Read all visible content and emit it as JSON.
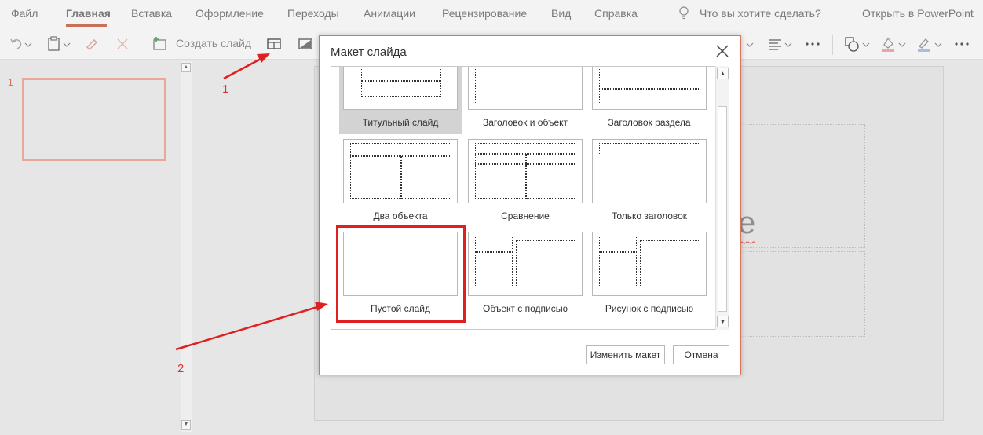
{
  "ribbon": {
    "tabs": [
      "Файл",
      "Главная",
      "Вставка",
      "Оформление",
      "Переходы",
      "Анимации",
      "Рецензирование",
      "Вид",
      "Справка"
    ],
    "active_tab": "Главная",
    "tell_me": "Что вы хотите сделать?",
    "open_in_app": "Открыть в PowerPoint"
  },
  "toolbar": {
    "new_slide_label": "Создать слайд"
  },
  "thumbnails": {
    "slide_number": "1"
  },
  "annotations": {
    "step1": "1",
    "step2": "2",
    "accent_color": "#e02020"
  },
  "dialog": {
    "title": "Макет слайда",
    "layouts": [
      {
        "label": "Титульный слайд",
        "selected": true
      },
      {
        "label": "Заголовок и объект",
        "selected": false
      },
      {
        "label": "Заголовок раздела",
        "selected": false
      },
      {
        "label": "Два объекта",
        "selected": false
      },
      {
        "label": "Сравнение",
        "selected": false
      },
      {
        "label": "Только заголовок",
        "selected": false
      },
      {
        "label": "Пустой слайд",
        "selected": false
      },
      {
        "label": "Объект с подписью",
        "selected": false
      },
      {
        "label": "Рисунок с подписью",
        "selected": false
      }
    ],
    "change_button": "Изменить макет",
    "cancel_button": "Отмена"
  },
  "slide": {
    "ghost_text": "e"
  }
}
